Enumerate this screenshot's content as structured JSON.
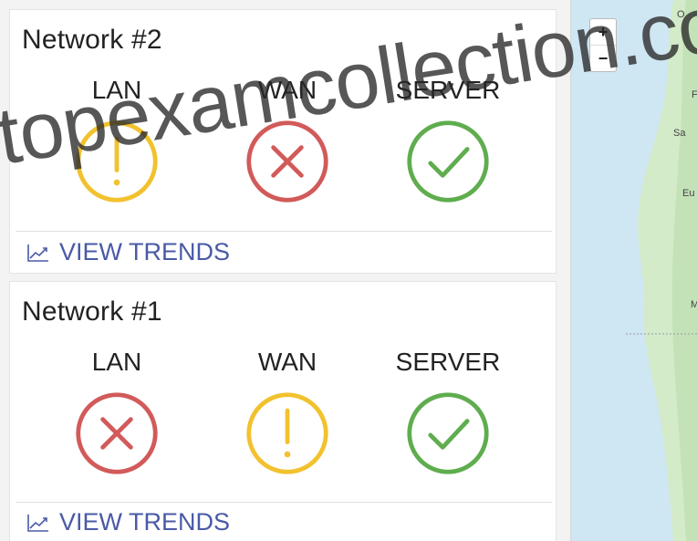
{
  "networks": [
    {
      "title": "Network #2",
      "statuses": [
        {
          "label": "LAN",
          "state": "warning",
          "icon": "warning-icon"
        },
        {
          "label": "WAN",
          "state": "error",
          "icon": "error-icon"
        },
        {
          "label": "SERVER",
          "state": "ok",
          "icon": "check-icon"
        }
      ],
      "trends_label": "VIEW TRENDS"
    },
    {
      "title": "Network #1",
      "statuses": [
        {
          "label": "LAN",
          "state": "error",
          "icon": "error-icon"
        },
        {
          "label": "WAN",
          "state": "warning",
          "icon": "warning-icon"
        },
        {
          "label": "SERVER",
          "state": "ok",
          "icon": "check-icon"
        }
      ],
      "trends_label": "VIEW TRENDS"
    }
  ],
  "map": {
    "zoom_in_label": "+",
    "zoom_out_label": "−",
    "labels": [
      "O",
      "F",
      "Sa",
      "Eu",
      "M"
    ]
  },
  "colors": {
    "warning": "#f2c12e",
    "error": "#d25a5a",
    "ok": "#5fad4e",
    "link": "#4a5aa6"
  },
  "watermark": "topexamcollection.com"
}
